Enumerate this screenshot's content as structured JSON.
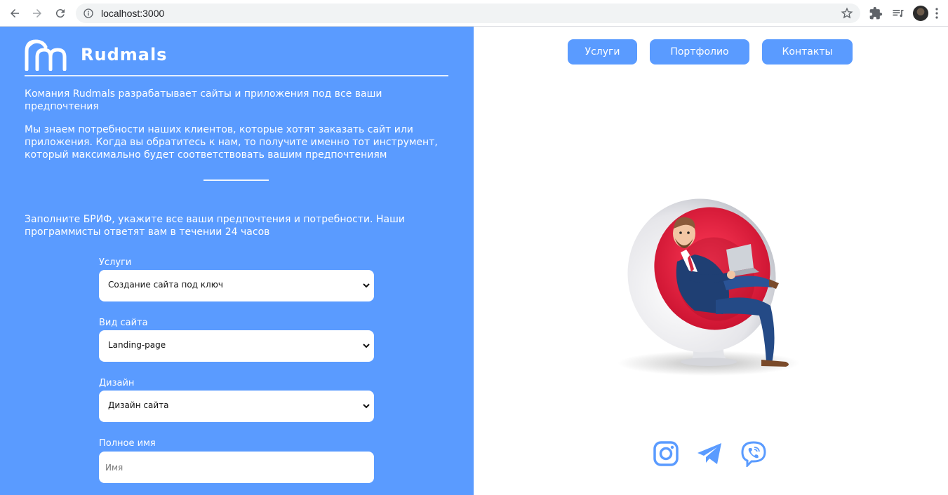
{
  "browser": {
    "url": "localhost:3000",
    "icons": [
      "back-icon",
      "forward-icon",
      "reload-icon",
      "site-info-icon",
      "bookmark-star-icon",
      "extensions-icon",
      "media-control-icon",
      "profile-avatar",
      "menu-icon"
    ]
  },
  "brand": {
    "name": "Rudmals",
    "accent": "#5a9bff"
  },
  "intro": {
    "line1": "Комания Rudmals разрабатывает сайты и приложения под все ваши предпочтения",
    "line2": "Мы знаем потребности наших клиентов, которые хотят заказать сайт или приложения. Когда вы обратитесь к нам, то получите именно тот инструмент, который максимально будет соответствовать вашим предпочтениям",
    "brief": "Заполните БРИФ, укажите все ваши предпочтения и потребности. Наши программисты ответят вам в течении 24 часов"
  },
  "form": {
    "services_label": "Услуги",
    "services_value": "Создание сайта под ключ",
    "site_type_label": "Вид сайта",
    "site_type_value": "Landing-page",
    "design_label": "Дизайн",
    "design_value": "Дизайн сайта",
    "fullname_label": "Полное имя",
    "fullname_placeholder": "Имя"
  },
  "nav": {
    "services": "Услуги",
    "portfolio": "Портфолио",
    "contacts": "Контакты"
  },
  "social": [
    "instagram-icon",
    "telegram-icon",
    "viber-icon"
  ]
}
